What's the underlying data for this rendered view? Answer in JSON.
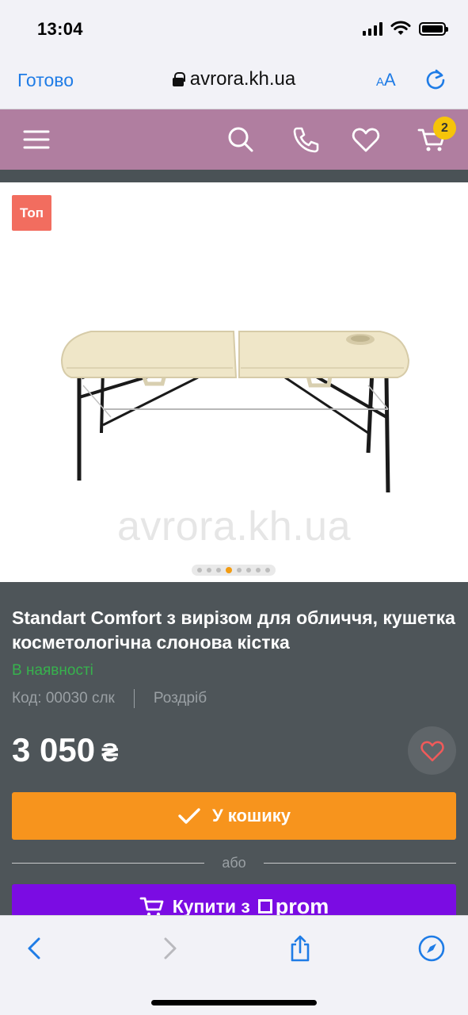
{
  "status_bar": {
    "time": "13:04"
  },
  "browser": {
    "done_label": "Готово",
    "url": "avrora.kh.ua",
    "text_size_label": "AA"
  },
  "header": {
    "cart_count": "2"
  },
  "product": {
    "badge": "Топ",
    "watermark": "avrora.kh.ua",
    "title": "Standart Comfort з вирізом для обличчя, кушетка косметологічна слонова кістка",
    "availability": "В наявності",
    "code": "Код: 00030 слк",
    "sale_type": "Роздріб",
    "price": "3 050",
    "currency": "₴",
    "gallery_count": 8,
    "gallery_active_index": 3
  },
  "actions": {
    "add_to_cart": "У кошику",
    "or": "або",
    "buy_with_prom": "Купити з",
    "prom_logo_text": "prom"
  },
  "colors": {
    "header_bg": "#b07ea0",
    "accent_orange": "#f7941d",
    "prom_purple": "#7b0ce3",
    "badge_red": "#f26d5f",
    "in_stock_green": "#37b24d",
    "safari_blue": "#1f7ce6"
  }
}
